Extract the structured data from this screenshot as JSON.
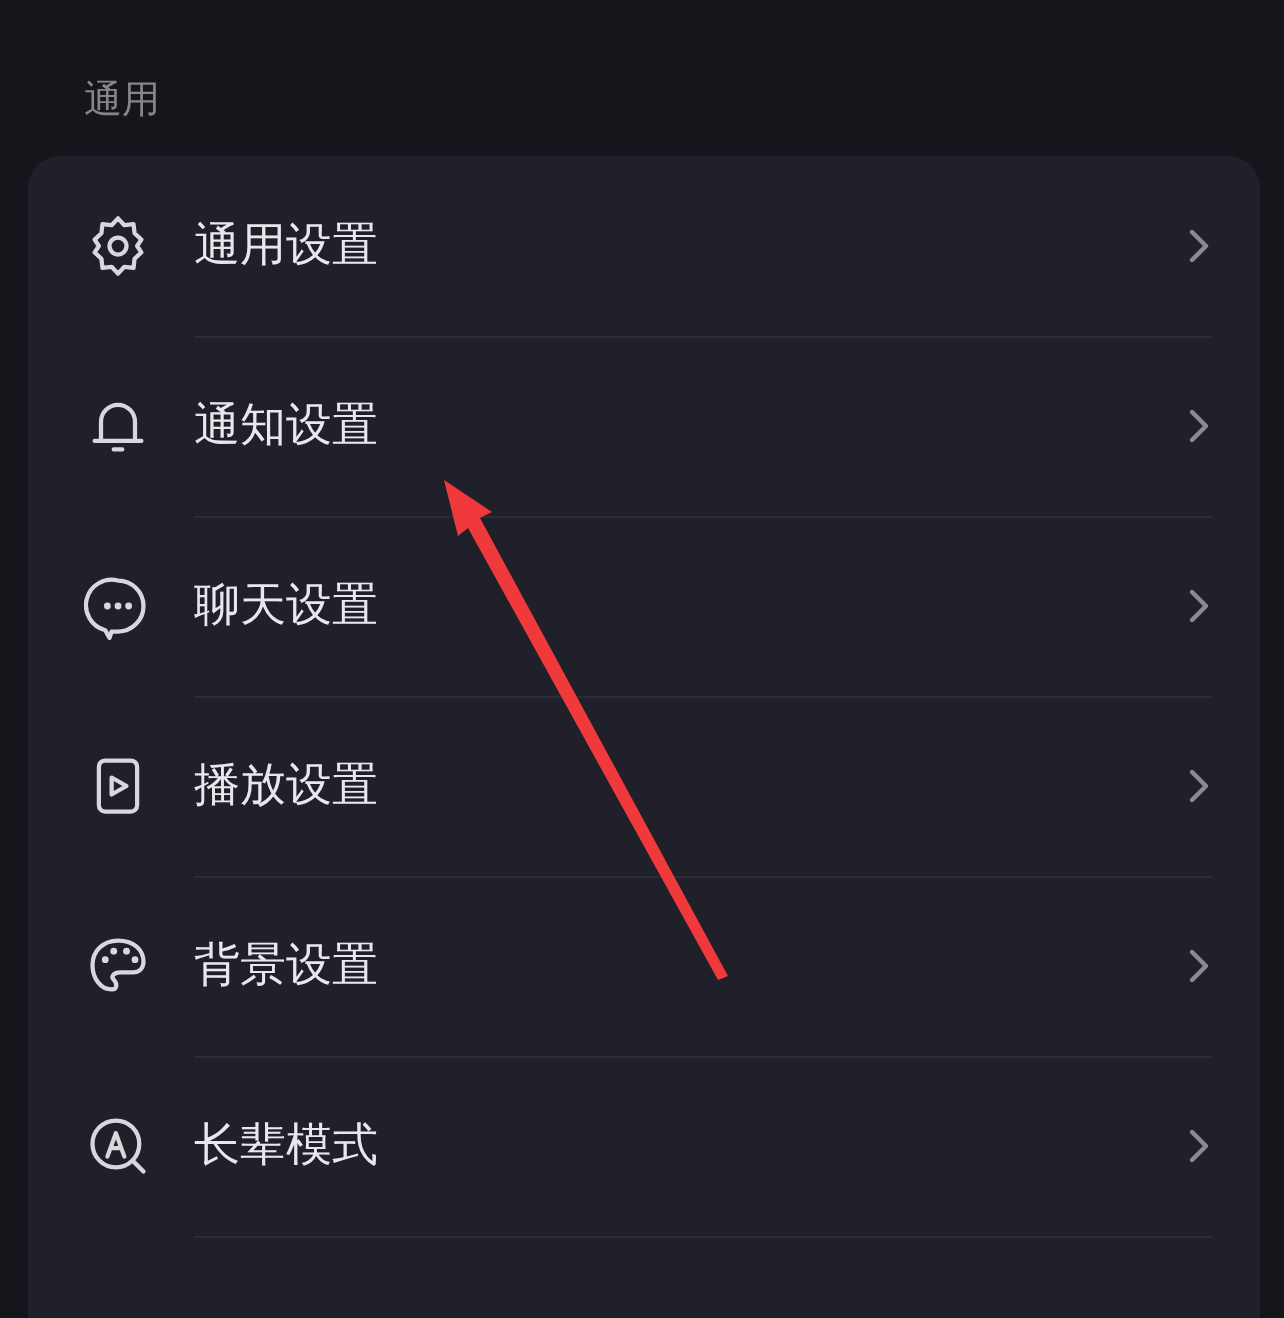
{
  "section": {
    "title": "通用"
  },
  "items": [
    {
      "label": "通用设置"
    },
    {
      "label": "通知设置"
    },
    {
      "label": "聊天设置"
    },
    {
      "label": "播放设置"
    },
    {
      "label": "背景设置"
    },
    {
      "label": "长辈模式"
    }
  ]
}
